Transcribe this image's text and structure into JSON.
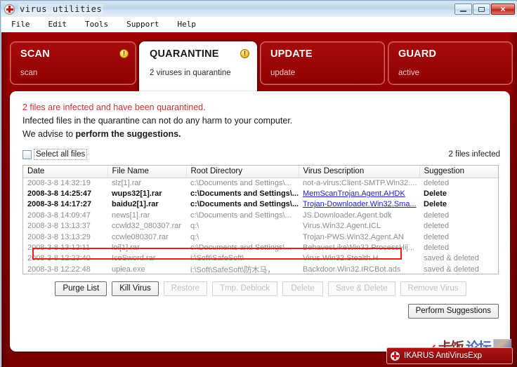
{
  "window": {
    "title": "virus utilities",
    "icon": "medical-cross-icon",
    "minimize_label": "",
    "maximize_label": "",
    "close_label": "×"
  },
  "menubar": {
    "items": [
      {
        "label": "File"
      },
      {
        "label": "Edit"
      },
      {
        "label": "Tools"
      },
      {
        "label": "Support"
      },
      {
        "label": "Help"
      }
    ]
  },
  "tabs": [
    {
      "id": "scan",
      "title": "SCAN",
      "subtitle": "scan",
      "active": false,
      "warning": true,
      "badge": "!"
    },
    {
      "id": "quarantine",
      "title": "QUARANTINE",
      "subtitle": "2 viruses in quarantine",
      "active": true,
      "warning": true,
      "badge": "!"
    },
    {
      "id": "update",
      "title": "UPDATE",
      "subtitle": "update",
      "active": false,
      "warning": false,
      "badge": ""
    },
    {
      "id": "guard",
      "title": "GUARD",
      "subtitle": "active",
      "active": false,
      "warning": false,
      "badge": ""
    }
  ],
  "message": {
    "line1": "2 files are infected and have been quarantined.",
    "line2": "Infected files in the quarantine can not do any harm to your computer.",
    "line3_prefix": "We advise to ",
    "line3_bold": "perform the suggestions."
  },
  "select_bar": {
    "checkbox_label": "Select all files",
    "checked": false,
    "infected_count": "2 files infected"
  },
  "table": {
    "columns": [
      "Date",
      "File Name",
      "Root Directory",
      "Virus Description",
      "Suggestion"
    ],
    "rows": [
      {
        "date": "2008-3-8 14:32:19",
        "file": "slz[1].rar",
        "root": "c:\\Documents and Settings\\...",
        "virus": "not-a-virus:Client-SMTP.Win32....",
        "suggestion": "deleted",
        "highlighted": true,
        "strong": false
      },
      {
        "date": "2008-3-8 14:25:47",
        "file": "wups32[1].rar",
        "root": "c:\\Documents and Settings\\...",
        "virus": "MemScanTrojan.Agent.AHDK",
        "suggestion": "Delete",
        "highlighted": false,
        "strong": true
      },
      {
        "date": "2008-3-8 14:17:27",
        "file": "baidu2[1].rar",
        "root": "c:\\Documents and Settings\\...",
        "virus": "Trojan-Downloader.Win32.Sma...",
        "suggestion": "Delete",
        "highlighted": false,
        "strong": true
      },
      {
        "date": "2008-3-8 14:09:47",
        "file": "news[1].rar",
        "root": "c:\\Documents and Settings\\...",
        "virus": "JS.Downloader.Agent.bdk",
        "suggestion": "deleted",
        "highlighted": false,
        "strong": false
      },
      {
        "date": "2008-3-8 13:13:37",
        "file": "ccwld32_080307.rar",
        "root": "q:\\",
        "virus": "Virus.Win32.Agent.ICL",
        "suggestion": "deleted",
        "highlighted": false,
        "strong": false
      },
      {
        "date": "2008-3-8 13:13:29",
        "file": "ccwle080307.rar",
        "root": "q:\\",
        "virus": "Trojan-PWS.Win32.Agent.AN",
        "suggestion": "deleted",
        "highlighted": false,
        "strong": false
      },
      {
        "date": "2008-3-8 13:12:11",
        "file": "loi[1].rar",
        "root": "c:\\Documents and Settings\\...",
        "virus": "BehavesLikeWin32.ProcessHij...",
        "suggestion": "deleted",
        "highlighted": false,
        "strong": false
      },
      {
        "date": "2008-3-8 12:23:40",
        "file": "IceSword.rar",
        "root": "i:\\Soft\\SafeSoft\\",
        "virus": "Virus.Win32.Stealth.H",
        "suggestion": "saved & deleted",
        "highlighted": false,
        "strong": false
      },
      {
        "date": "2008-3-8 12:22:48",
        "file": "upiea.exe",
        "root": "i:\\Soft\\SafeSoft\\防木马，",
        "virus": "Backdoor.Win32.IRCBot.ads",
        "suggestion": "saved & deleted",
        "highlighted": false,
        "strong": false
      }
    ]
  },
  "buttons": [
    {
      "id": "purge-list",
      "label": "Purge List",
      "enabled": true
    },
    {
      "id": "kill-virus",
      "label": "Kill Virus",
      "enabled": true
    },
    {
      "id": "restore",
      "label": "Restore",
      "enabled": false
    },
    {
      "id": "tmp-deblock",
      "label": "Tmp. Deblock",
      "enabled": false
    },
    {
      "id": "delete",
      "label": "Delete",
      "enabled": false
    },
    {
      "id": "save-delete",
      "label": "Save & Delete",
      "enabled": false
    },
    {
      "id": "remove-virus",
      "label": "Remove Virus",
      "enabled": false
    }
  ],
  "perform_button": {
    "label": "Perform Suggestions",
    "enabled": true
  },
  "brand": {
    "text": "IKARUS AntiVirusExp",
    "logo": "medical-cross-icon"
  },
  "watermark": {
    "arrow": "‹",
    "cn_red": "卡饭",
    "cn_blue": "论坛"
  },
  "colors": {
    "frame_red": "#8d0000",
    "alert_red": "#cf3333",
    "highlight_red": "#ea1c1c",
    "link_blue": "#2222bb"
  }
}
